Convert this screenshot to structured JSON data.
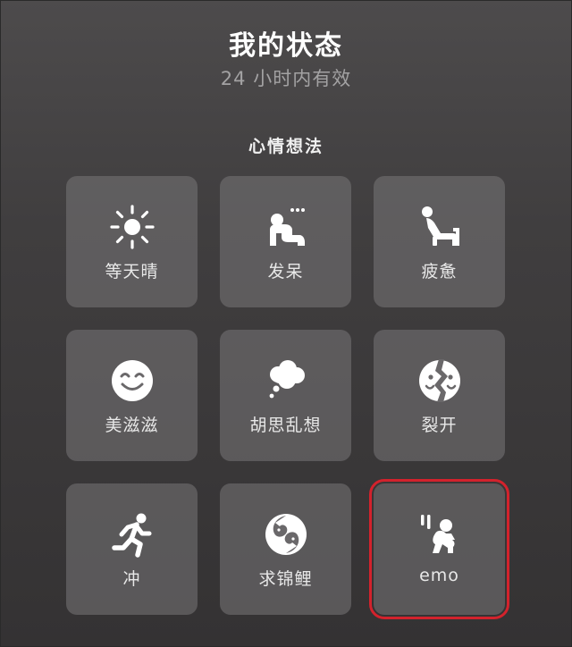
{
  "header": {
    "title": "我的状态",
    "subtitle": "24 小时内有效"
  },
  "section": {
    "label": "心情想法"
  },
  "statuses": [
    {
      "label": "等天晴",
      "icon": "sun-icon"
    },
    {
      "label": "发呆",
      "icon": "daydream-icon"
    },
    {
      "label": "疲惫",
      "icon": "tired-icon"
    },
    {
      "label": "美滋滋",
      "icon": "smile-icon"
    },
    {
      "label": "胡思乱想",
      "icon": "thought-cloud-icon"
    },
    {
      "label": "裂开",
      "icon": "cracked-face-icon"
    },
    {
      "label": "冲",
      "icon": "running-icon"
    },
    {
      "label": "求锦鲤",
      "icon": "koi-icon"
    },
    {
      "label": "emo",
      "icon": "emo-sitting-icon"
    }
  ],
  "selected_status": "emo",
  "colors": {
    "background": "#403e3f",
    "tile": "#6a686a",
    "subtitle": "#a3a2a3",
    "selection_border": "#d3222c"
  }
}
